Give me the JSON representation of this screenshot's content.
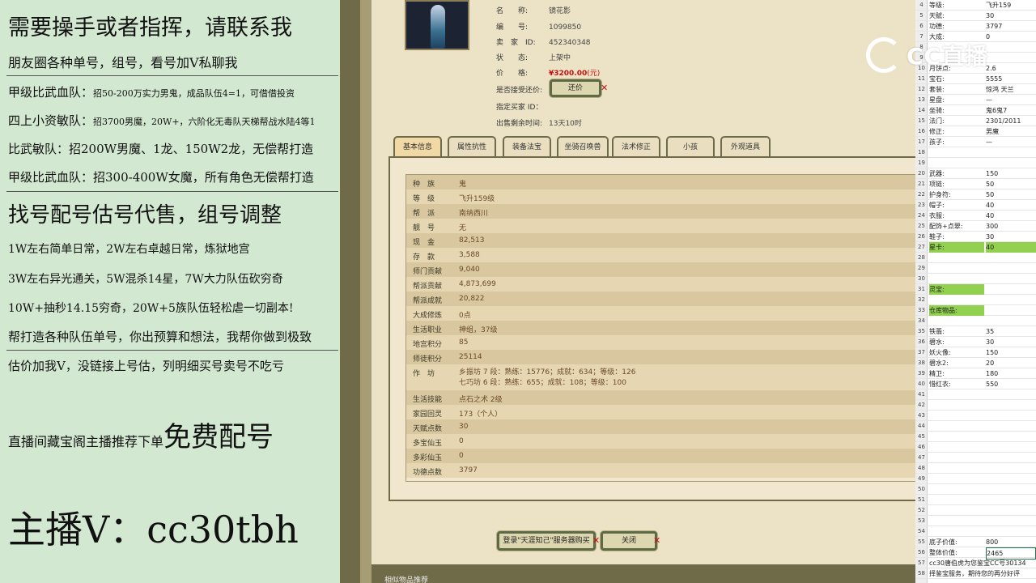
{
  "promo": {
    "line1": "需要操手或者指挥，请联系我",
    "line2": "朋友圈各种单号，组号，看号加V私聊我",
    "line3_a": "甲级比武血队：",
    "line3_b": "招50-200万实力男鬼，成品队伍4=1，可借借投资",
    "line4_a": "四上小资敏队：",
    "line4_b": "招3700男魔，20W+，六阶化无毒队天梯帮战水陆4等1",
    "line5": "比武敏队：招200W男魔、1龙、150W2龙，无偿帮打造",
    "line6": "甲级比武血队：招300-400W女魔，所有角色无偿帮打造",
    "line7": "找号配号估号代售，组号调整",
    "line8": "1W左右简单日常，2W左右卓越日常，炼狱地宫",
    "line9": "3W左右异光通关，5W混杀14星，7W大力队伍砍穷奇",
    "line10": "10W+抽秒14.15穷奇，20W+5族队伍轻松虐一切副本!",
    "line11": "帮打造各种队伍单号，你出预算和想法，我帮你做到极致",
    "line12": "估价加我V，没链接上号估，列明细买号卖号不吃亏",
    "line13_a": "直播间藏宝阁主播推荐下单",
    "line13_b": "免费配号",
    "line14": "主播V：cc30tbh"
  },
  "item": {
    "name_label": "名　　称:",
    "name": "镜花影",
    "id_label": "编　　号:",
    "id": "1099850",
    "seller_label": "卖　家　ID:",
    "seller_id": "452340348",
    "status_label": "状　　态:",
    "status": "上架中",
    "price_label": "价　　格:",
    "price": "¥3200.00",
    "price_unit": "(元)",
    "bargain_label": "是否接受还价:",
    "bargain_button": "还价",
    "buyer_label": "指定买家 ID：",
    "time_label": "出售剩余时间:",
    "time_value": "13天10时"
  },
  "tabs": [
    "基本信息",
    "属性抗性",
    "装备法宝",
    "坐骑召唤兽",
    "法术修正",
    "小孩",
    "外观道具"
  ],
  "attributes": [
    {
      "k": "种　族",
      "v": "鬼"
    },
    {
      "k": "等　级",
      "v": "飞升159级"
    },
    {
      "k": "帮　派",
      "v": "南纳西川"
    },
    {
      "k": "靓　号",
      "v": "无"
    },
    {
      "k": "现　金",
      "v": "82,513"
    },
    {
      "k": "存　款",
      "v": "3,588"
    },
    {
      "k": "师门贡献",
      "v": "9,040"
    },
    {
      "k": "帮派贡献",
      "v": "4,873,699"
    },
    {
      "k": "帮派成就",
      "v": "20,822"
    },
    {
      "k": "大成修炼",
      "v": "0点"
    },
    {
      "k": "生活职业",
      "v": "神组，37级"
    },
    {
      "k": "地宫积分",
      "v": "85"
    },
    {
      "k": "师徒积分",
      "v": "25114"
    },
    {
      "k": "作　坊",
      "v": "乡振坊 7 段：熟练：15776；成就：634；等级：126",
      "v2": "七巧坊 6 段：熟练：655；成就：108；等级：100"
    },
    {
      "k": "生活技能",
      "v": "点石之术 2级"
    },
    {
      "k": "家园回灵",
      "v": "173（个人）"
    },
    {
      "k": "天赋点数",
      "v": "30"
    },
    {
      "k": "多宝仙玉",
      "v": "0"
    },
    {
      "k": "多彩仙玉",
      "v": "0"
    },
    {
      "k": "功德点数",
      "v": "3797"
    }
  ],
  "bottom_buttons": {
    "login": "登录\"天涯知己\"服务器购买",
    "close": "关闭"
  },
  "bottom_bar_text": "相似物品推荐",
  "sheet": [
    {
      "n": "4",
      "c1": "等级:",
      "c2": "飞升159"
    },
    {
      "n": "5",
      "c1": "天赋:",
      "c2": "30"
    },
    {
      "n": "6",
      "c1": "功德:",
      "c2": "3797"
    },
    {
      "n": "7",
      "c1": "大成:",
      "c2": "0"
    },
    {
      "n": "8",
      "c1": "",
      "c2": ""
    },
    {
      "n": "9",
      "c1": "",
      "c2": ""
    },
    {
      "n": "10",
      "c1": "月饼点:",
      "c2": "2.6"
    },
    {
      "n": "11",
      "c1": "宝石:",
      "c2": "5555"
    },
    {
      "n": "12",
      "c1": "套装:",
      "c2": "惊鸿 天兰"
    },
    {
      "n": "13",
      "c1": "星盘:",
      "c2": "—"
    },
    {
      "n": "14",
      "c1": "坐骑:",
      "c2": "鬼6鬼7"
    },
    {
      "n": "15",
      "c1": "法门:",
      "c2": "2301/2011"
    },
    {
      "n": "16",
      "c1": "修正:",
      "c2": "男魔"
    },
    {
      "n": "17",
      "c1": "孩子:",
      "c2": "—"
    },
    {
      "n": "18",
      "c1": "",
      "c2": ""
    },
    {
      "n": "19",
      "c1": "",
      "c2": ""
    },
    {
      "n": "20",
      "c1": "武器:",
      "c2": "150"
    },
    {
      "n": "21",
      "c1": "项链:",
      "c2": "50"
    },
    {
      "n": "22",
      "c1": "护身符:",
      "c2": "50"
    },
    {
      "n": "23",
      "c1": "帽子:",
      "c2": "40"
    },
    {
      "n": "24",
      "c1": "衣服:",
      "c2": "40"
    },
    {
      "n": "25",
      "c1": "配饰+点翠:",
      "c2": "300"
    },
    {
      "n": "26",
      "c1": "鞋子:",
      "c2": "30"
    },
    {
      "n": "27",
      "c1": "星卡:",
      "c2": "40"
    },
    {
      "n": "28",
      "c1": "",
      "c2": ""
    },
    {
      "n": "29",
      "c1": "",
      "c2": ""
    },
    {
      "n": "30",
      "c1": "",
      "c2": ""
    },
    {
      "n": "31",
      "c1": "灵宝:",
      "c2": ""
    },
    {
      "n": "32",
      "c1": "",
      "c2": ""
    },
    {
      "n": "33",
      "c1": "仓库物品:",
      "c2": ""
    },
    {
      "n": "34",
      "c1": "",
      "c2": ""
    },
    {
      "n": "35",
      "c1": "铁翡:",
      "c2": "35"
    },
    {
      "n": "36",
      "c1": "碧水:",
      "c2": "30"
    },
    {
      "n": "37",
      "c1": "妖火像:",
      "c2": "150"
    },
    {
      "n": "38",
      "c1": "碧水2:",
      "c2": "20"
    },
    {
      "n": "39",
      "c1": "精卫:",
      "c2": "180"
    },
    {
      "n": "40",
      "c1": "惜红衣:",
      "c2": "550"
    },
    {
      "n": "41",
      "c1": "",
      "c2": ""
    },
    {
      "n": "42",
      "c1": "",
      "c2": ""
    },
    {
      "n": "43",
      "c1": "",
      "c2": ""
    },
    {
      "n": "44",
      "c1": "",
      "c2": ""
    },
    {
      "n": "45",
      "c1": "",
      "c2": ""
    },
    {
      "n": "46",
      "c1": "",
      "c2": ""
    },
    {
      "n": "47",
      "c1": "",
      "c2": ""
    },
    {
      "n": "48",
      "c1": "",
      "c2": ""
    },
    {
      "n": "49",
      "c1": "",
      "c2": ""
    },
    {
      "n": "50",
      "c1": "",
      "c2": ""
    },
    {
      "n": "51",
      "c1": "",
      "c2": ""
    },
    {
      "n": "52",
      "c1": "",
      "c2": ""
    },
    {
      "n": "53",
      "c1": "",
      "c2": ""
    },
    {
      "n": "54",
      "c1": "",
      "c2": ""
    },
    {
      "n": "55",
      "c1": "底子价值:",
      "c2": "800"
    },
    {
      "n": "56",
      "c1": "整体价值:",
      "c2": "2465"
    },
    {
      "n": "57",
      "c1": "cc30唐伯虎为您鉴宝CC号30134",
      "c2": ""
    },
    {
      "n": "58",
      "c1": "择鉴宝服务，期待您的再分好评",
      "c2": ""
    }
  ],
  "watermark": "CC直播",
  "colors": {
    "highlight": "#92d050",
    "price": "#c81010",
    "frame": "#6f6a48"
  }
}
